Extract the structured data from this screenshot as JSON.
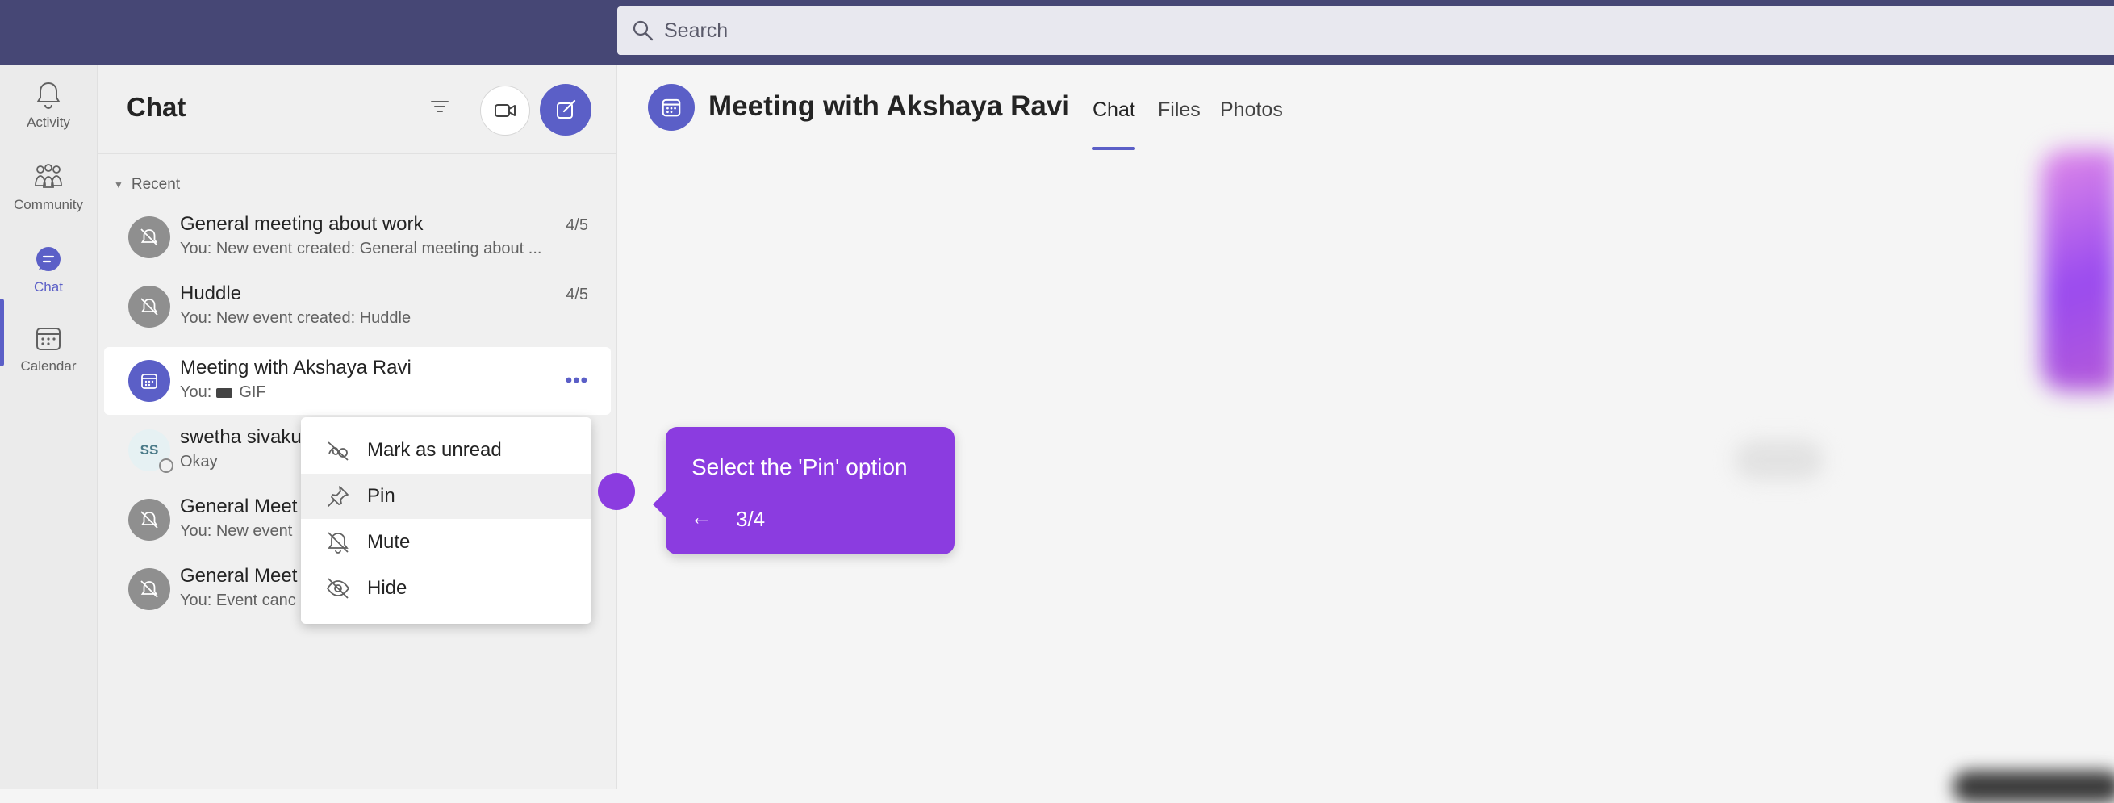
{
  "search": {
    "placeholder": "Search"
  },
  "rail": {
    "items": [
      {
        "label": "Activity",
        "icon": "bell-icon"
      },
      {
        "label": "Community",
        "icon": "community-icon"
      },
      {
        "label": "Chat",
        "icon": "chat-icon",
        "active": true
      },
      {
        "label": "Calendar",
        "icon": "calendar-icon"
      }
    ]
  },
  "chat_list": {
    "title": "Chat",
    "section": "Recent",
    "rows": [
      {
        "name": "General meeting about work",
        "preview": "You: New event created: General meeting about ...",
        "date": "4/5",
        "avatar": "muted-icon"
      },
      {
        "name": "Huddle",
        "preview": "You: New event created: Huddle",
        "date": "4/5",
        "avatar": "muted-icon"
      },
      {
        "name": "Meeting with Akshaya Ravi",
        "preview_prefix": "You:",
        "preview": "GIF",
        "more": "•••",
        "avatar": "calendar-icon"
      },
      {
        "name": "swetha sivaku",
        "preview": "Okay",
        "initials": "SS"
      },
      {
        "name": "General Meet",
        "preview": "You: New event",
        "avatar": "muted-icon"
      },
      {
        "name": "General Meet",
        "preview": "You: Event canc",
        "avatar": "muted-icon"
      }
    ]
  },
  "context_menu": {
    "items": [
      {
        "label": "Mark as unread",
        "icon": "mark-unread-icon"
      },
      {
        "label": "Pin",
        "icon": "pin-icon",
        "highlighted": true
      },
      {
        "label": "Mute",
        "icon": "mute-icon"
      },
      {
        "label": "Hide",
        "icon": "hide-icon"
      }
    ]
  },
  "main": {
    "title": "Meeting with Akshaya Ravi",
    "tabs": [
      "Chat",
      "Files",
      "Photos"
    ],
    "active_tab": "Chat"
  },
  "tour": {
    "text": "Select the 'Pin' option",
    "back": "←",
    "step": "3/4"
  },
  "colors": {
    "topbar": "#464775",
    "accent": "#5b5fc7",
    "tooltip": "#8b3ce0"
  }
}
